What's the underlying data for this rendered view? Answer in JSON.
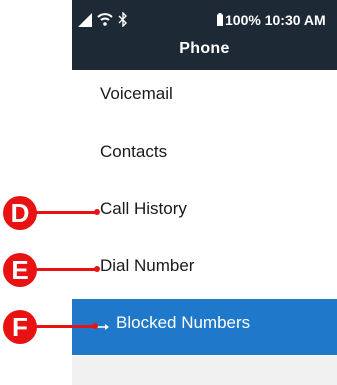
{
  "status": {
    "battery": "100%",
    "time": "10:30 AM"
  },
  "header": {
    "title": "Phone"
  },
  "menu": {
    "items": [
      {
        "label": "Voicemail"
      },
      {
        "label": "Contacts"
      },
      {
        "label": "Call History"
      },
      {
        "label": "Dial Number"
      },
      {
        "label": "Blocked Numbers",
        "selected": true
      }
    ]
  },
  "callouts": [
    "D",
    "E",
    "F"
  ],
  "colors": {
    "header_bg": "#1d2a36",
    "selected_bg": "#1f78c9",
    "callout": "#e81212"
  }
}
